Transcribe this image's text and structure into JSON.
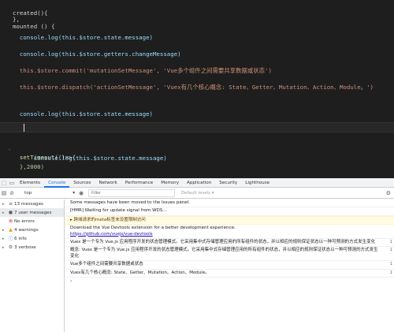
{
  "editor": {
    "line0": "created(){ ",
    "line1": "},",
    "line2": "mounted () {",
    "line3": "  console.log(this.$store.state.message)",
    "line4": "  console.log(this.$store.getters.changeMessage)",
    "line5": "  this.$store.commit('mutationSetMessage', 'Vue多个组件之间需要共享数据或状态')",
    "line6": "  this.$store.dispatch('actionSetMessage', 'Vuex有几个核心概念: State、Getter、Mutation、Action、Module。')",
    "line7": "  console.log(this.$store.state.message)",
    "line8": "  setTimeout(()=>{",
    "line9": "      console.log(this.$store.state.message)",
    "line10": "  },2000)"
  },
  "devtools": {
    "tabs": [
      "Elements",
      "Console",
      "Sources",
      "Network",
      "Performance",
      "Memory",
      "Application",
      "Security",
      "Lighthouse"
    ],
    "active_tab": "Console",
    "context": "top",
    "filter_placeholder": "Filter",
    "levels": "Default levels ▾",
    "sidebar": [
      {
        "label": "13 messages",
        "icon": "list-icon"
      },
      {
        "label": "7 user messages",
        "icon": "user-icon"
      },
      {
        "label": "No errors",
        "icon": "error-icon"
      },
      {
        "label": "4 warnings",
        "icon": "warning-icon"
      },
      {
        "label": "6 info",
        "icon": "info-icon"
      },
      {
        "label": "3 verbose",
        "icon": "verbose-icon"
      }
    ],
    "messages": [
      {
        "text": "Some messages have been moved to the Issues panel.",
        "type": "info",
        "src": ""
      },
      {
        "text": "[HMR] Waiting for update signal from WDS...",
        "type": "log",
        "src": ""
      },
      {
        "text": "▸ 跨域请求的meta标签未设置限制访问",
        "type": "warn",
        "src": ""
      },
      {
        "text": "Download the Vue Devtools extension for a better development experience:",
        "type": "log",
        "src": "",
        "link": "https://github.com/vuejs/vue-devtools"
      },
      {
        "text": "Vuex 是一个专为 Vue.js 应用程序开发的状态管理模式。它采用集中式存储管理应用的所有组件的状态，并以相应的规则保证状态以一种可预测的方式发生变化",
        "type": "log",
        "src": "1"
      },
      {
        "text": "概念: Vuex 是一个专为 Vue.js 应用程序开发的状态管理模式。它采用集中式存储管理应用的所有组件的状态，并以相应的规则保证状态以一种可预测的方式发生变化",
        "type": "log",
        "src": "1"
      },
      {
        "text": "Vue多个组件之间需要共享数据或状态",
        "type": "log",
        "src": "1"
      },
      {
        "text": "Vuex有几个核心概念: State、Getter、Mutation、Action、Module。",
        "type": "log",
        "src": "1"
      }
    ],
    "prompt": "›"
  }
}
